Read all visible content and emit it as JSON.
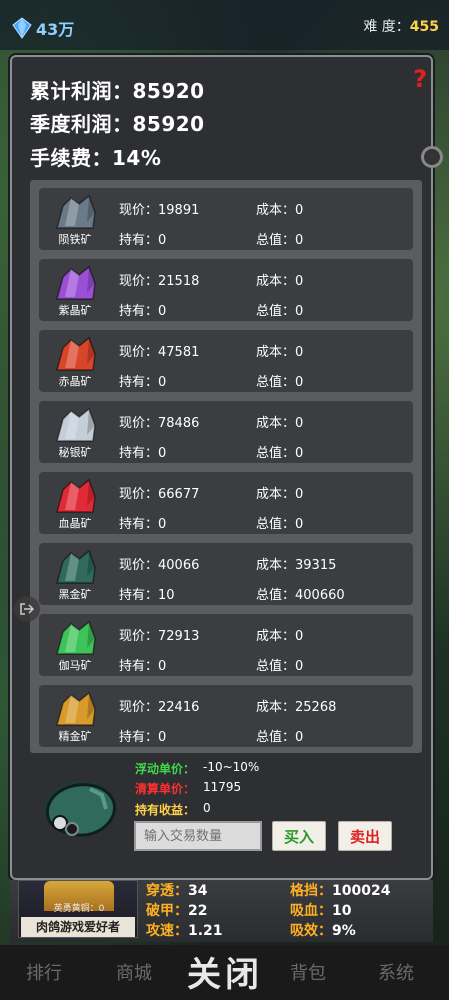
{
  "header": {
    "gem_value": "43万",
    "difficulty_label": "难 度：",
    "difficulty_value": "455"
  },
  "summary": {
    "total_profit": "累计利润：85920",
    "quarter_profit": "季度利润：85920",
    "fee": "手续费：14%"
  },
  "ores": [
    {
      "name": "陨铁矿",
      "price": "现价：19891",
      "cost": "成本：0",
      "hold": "持有：0",
      "total": "总值：0",
      "color": "#6a7a88"
    },
    {
      "name": "紫晶矿",
      "price": "现价：21518",
      "cost": "成本：0",
      "hold": "持有：0",
      "total": "总值：0",
      "color": "#9b4fd6"
    },
    {
      "name": "赤晶矿",
      "price": "现价：47581",
      "cost": "成本：0",
      "hold": "持有：0",
      "total": "总值：0",
      "color": "#d8452a"
    },
    {
      "name": "秘银矿",
      "price": "现价：78486",
      "cost": "成本：0",
      "hold": "持有：0",
      "total": "总值：0",
      "color": "#c4cdd8"
    },
    {
      "name": "血晶矿",
      "price": "现价：66677",
      "cost": "成本：0",
      "hold": "持有：0",
      "total": "总值：0",
      "color": "#e02a36"
    },
    {
      "name": "黑金矿",
      "price": "现价：40066",
      "cost": "成本：39315",
      "hold": "持有：10",
      "total": "总值：400660",
      "color": "#2f6a5c"
    },
    {
      "name": "伽马矿",
      "price": "现价：72913",
      "cost": "成本：0",
      "hold": "持有：0",
      "total": "总值：0",
      "color": "#3ec35a"
    },
    {
      "name": "精金矿",
      "price": "现价：22416",
      "cost": "成本：25268",
      "hold": "持有：0",
      "total": "总值：0",
      "color": "#d89a2a"
    }
  ],
  "trade": {
    "float_label": "浮动单价：",
    "float_value": "-10~10%",
    "settle_label": "清算单价：",
    "settle_value": "11795",
    "hold_label": "持有收益：",
    "hold_value": "0",
    "input_placeholder": "输入交易数量",
    "buy_label": "买入",
    "sell_label": "卖出"
  },
  "hero": {
    "title": "英勇黄铜：0",
    "name": "肉鸽游戏爱好者",
    "stats": [
      {
        "k": "穿透：",
        "v": "34"
      },
      {
        "k": "破甲：",
        "v": "22"
      },
      {
        "k": "攻速：",
        "v": "1.21"
      },
      {
        "k": "格挡：",
        "v": "100024"
      },
      {
        "k": "吸血：",
        "v": "10"
      },
      {
        "k": "吸效：",
        "v": "9%"
      }
    ]
  },
  "nav": {
    "rank": "排行",
    "shop": "商城",
    "close": "关闭",
    "bag": "背包",
    "system": "系统"
  }
}
